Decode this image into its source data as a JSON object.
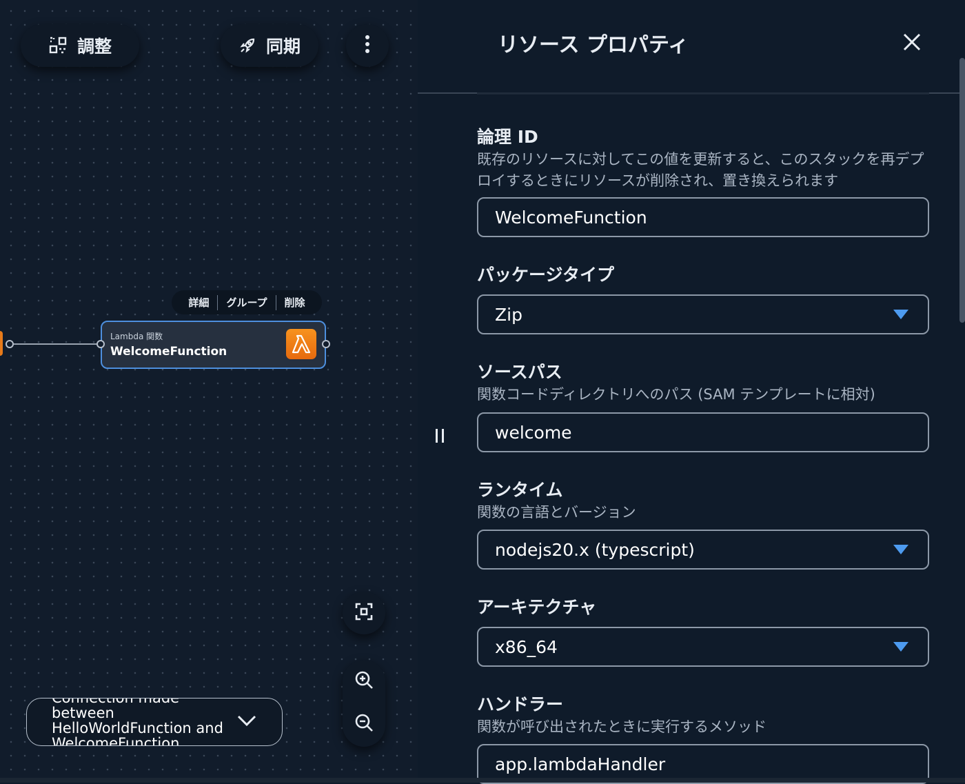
{
  "toolbar": {
    "arrange_label": "調整",
    "sync_label": "同期"
  },
  "node": {
    "menu": [
      "詳細",
      "グループ",
      "削除"
    ],
    "type_label": "Lambda 関数",
    "name": "WelcomeFunction"
  },
  "toast": {
    "message": "Connection made between HelloWorldFunction and WelcomeFunction"
  },
  "panel": {
    "title": "リソース プロパティ",
    "fields": [
      {
        "label": "論理 ID",
        "description": "既存のリソースに対してこの値を更新すると、このスタックを再デプロイするときにリソースが削除され、置き換えられます",
        "value": "WelcomeFunction"
      },
      {
        "label": "パッケージタイプ",
        "value": "Zip"
      },
      {
        "label": "ソースパス",
        "description": "関数コードディレクトリへのパス (SAM テンプレートに相対)",
        "value": "welcome"
      },
      {
        "label": "ランタイム",
        "description": "関数の言語とバージョン",
        "value": "nodejs20.x (typescript)"
      },
      {
        "label": "アーキテクチャ",
        "value": "x86_64"
      },
      {
        "label": "ハンドラー",
        "description": "関数が呼び出されたときに実行するメソッド",
        "value": "app.lambdaHandler"
      }
    ]
  },
  "colors": {
    "accent": "#4d9bf0",
    "lambda_orange": "#f7921e",
    "node_border": "#4d8fde"
  }
}
